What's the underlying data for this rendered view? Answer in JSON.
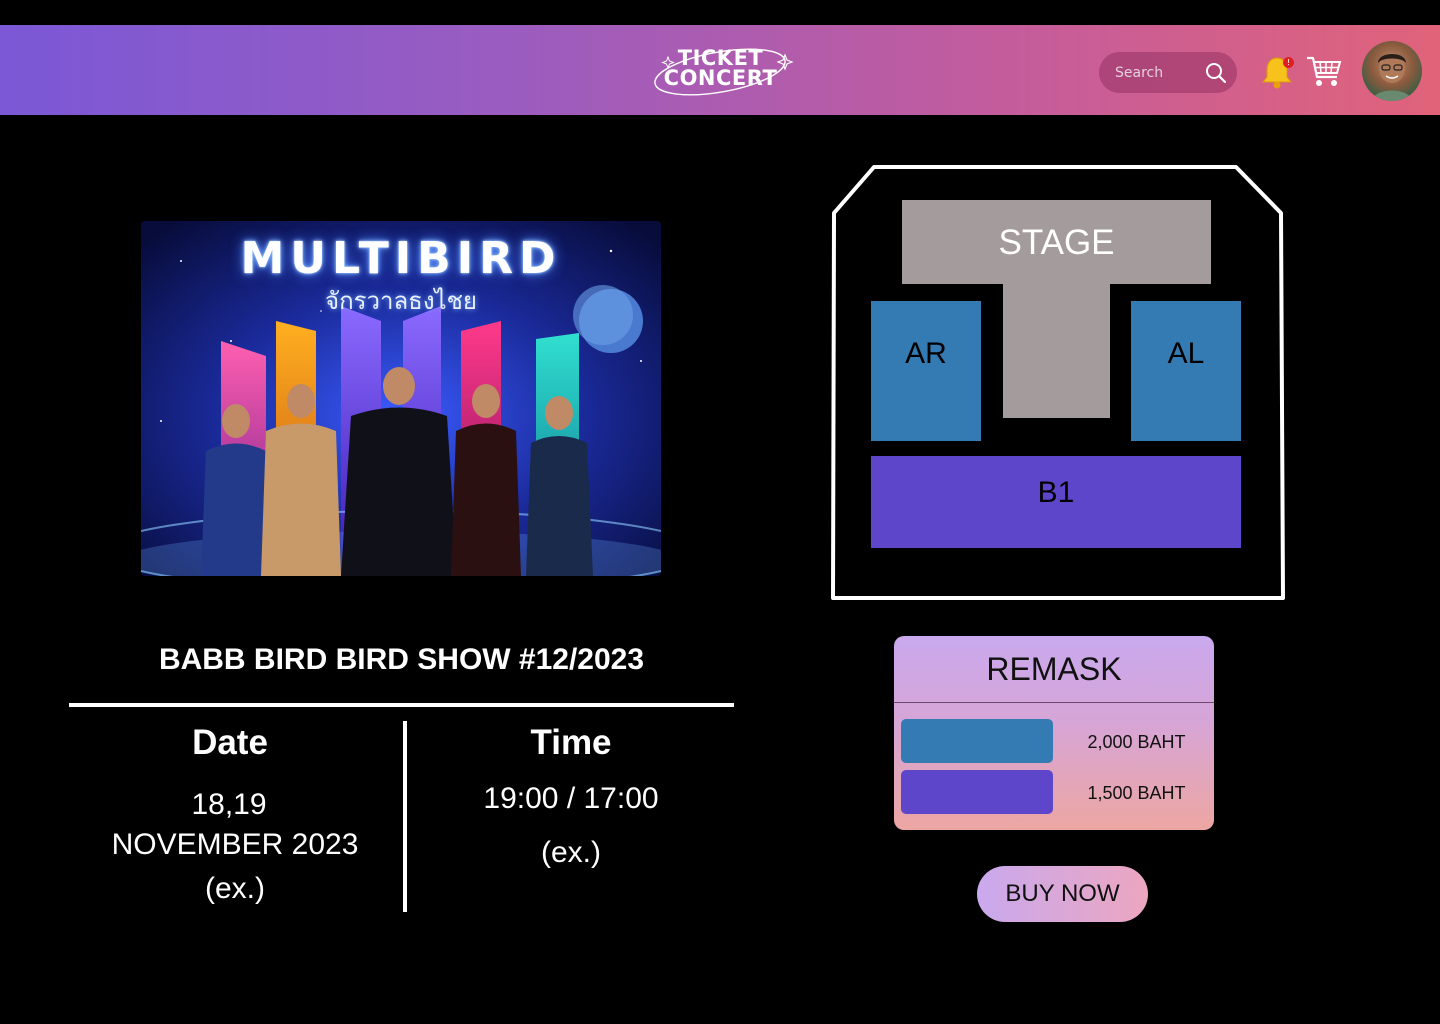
{
  "header": {
    "logo_line1": "TICKET",
    "logo_line2": "CONCERT",
    "search_placeholder": "Search",
    "notification_count": "!",
    "gradient_start": "#7b58d6",
    "gradient_end": "#e0637a"
  },
  "poster": {
    "title": "MULTIBIRD",
    "subtitle": "จักรวาลธงไชย"
  },
  "show": {
    "title": "BABB BIRD BIRD SHOW #12/2023",
    "date_label": "Date",
    "date_line1": "18,19",
    "date_line2": "NOVEMBER 2023",
    "date_line3": "(ex.)",
    "time_label": "Time",
    "time_line1": "19:00 / 17:00",
    "time_line2": "(ex.)"
  },
  "seatmap": {
    "stage": "STAGE",
    "zones": [
      "AR",
      "AL",
      "B1"
    ],
    "colors": {
      "stage": "#a49c9c",
      "zone_a": "#337bb2",
      "zone_b": "#5d46c9"
    }
  },
  "remark": {
    "title": "REMASK",
    "prices": [
      "2,000 BAHT",
      "1,500 BAHT"
    ]
  },
  "buy_button": "BUY NOW"
}
